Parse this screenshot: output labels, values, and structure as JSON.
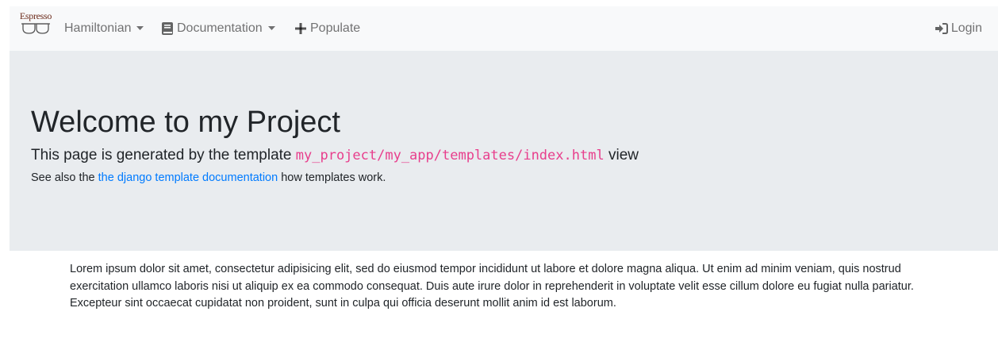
{
  "navbar": {
    "brand_text": "Espresso",
    "brand_color": "#6b2a1a",
    "items": [
      {
        "label": "Hamiltonian",
        "icon": "chevron-down-icon"
      },
      {
        "label": "Documentation",
        "icon": "book-icon"
      },
      {
        "label": "Populate",
        "icon": "plus-icon"
      }
    ],
    "login_label": "Login",
    "login_icon": "sign-in-icon"
  },
  "jumbotron": {
    "title": "Welcome to my Project",
    "lead_prefix": "This page is generated by the template ",
    "lead_code": "my_project/my_app/templates/index.html",
    "lead_suffix": " view",
    "see_prefix": "See also the ",
    "see_link": "the django template documentation",
    "see_suffix": " how templates work."
  },
  "content": {
    "paragraph": "Lorem ipsum dolor sit amet, consectetur adipisicing elit, sed do eiusmod tempor incididunt ut labore et dolore magna aliqua. Ut enim ad minim veniam, quis nostrud exercitation ullamco laboris nisi ut aliquip ex ea commodo consequat. Duis aute irure dolor in reprehenderit in voluptate velit esse cillum dolore eu fugiat nulla pariatur. Excepteur sint occaecat cupidatat non proident, sunt in culpa qui officia deserunt mollit anim id est laborum."
  },
  "colors": {
    "navbar_bg": "#f8f9fa",
    "jumbotron_bg": "#e9ecef",
    "link": "#007bff",
    "code": "#e83e8c"
  }
}
